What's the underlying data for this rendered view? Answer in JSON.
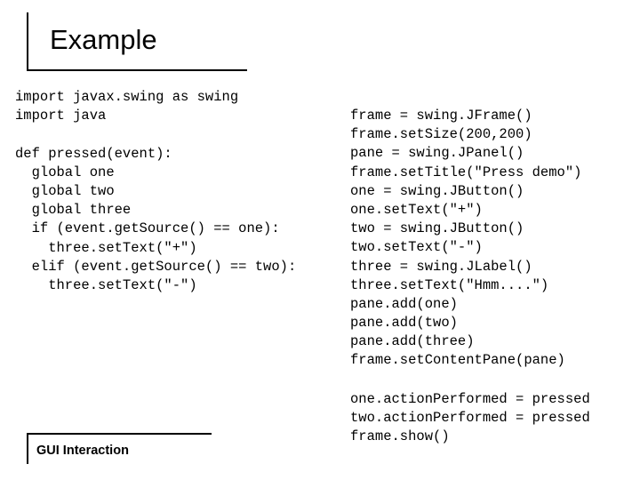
{
  "slide": {
    "title": "Example",
    "caption": "GUI Interaction",
    "code_left": [
      "import javax.swing as swing",
      "import java",
      "",
      "def pressed(event):",
      "  global one",
      "  global two",
      "  global three",
      "  if (event.getSource() == one):",
      "    three.setText(\"+\")",
      "  elif (event.getSource() == two):",
      "    three.setText(\"-\")"
    ],
    "code_right_top": [
      "frame = swing.JFrame()",
      "frame.setSize(200,200)",
      "pane = swing.JPanel()",
      "frame.setTitle(\"Press demo\")",
      "one = swing.JButton()",
      "one.setText(\"+\")",
      "two = swing.JButton()",
      "two.setText(\"-\")",
      "three = swing.JLabel()",
      "three.setText(\"Hmm....\")",
      "pane.add(one)",
      "pane.add(two)",
      "pane.add(three)",
      "frame.setContentPane(pane)"
    ],
    "code_right_bottom": [
      "one.actionPerformed = pressed",
      "two.actionPerformed = pressed",
      "frame.show()"
    ]
  },
  "colors": {
    "background": "#ffffff",
    "text": "#000000",
    "rule": "#000000"
  }
}
